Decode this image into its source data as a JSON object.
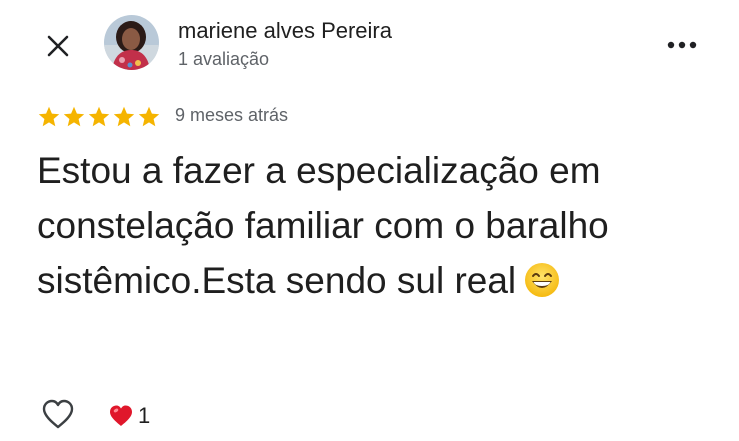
{
  "header": {
    "close_icon": "close-icon",
    "more_icon": "more-horizontal-icon"
  },
  "author": {
    "name": "mariene alves Pereira",
    "meta": "1 avaliação",
    "avatar": "avatar-photo"
  },
  "review": {
    "rating": 5,
    "rating_max": 5,
    "star_color": "#f5b400",
    "date": "9 meses atrás",
    "text": "Estou a fazer a especialização em constelação familiar com o baralho sistêmico.Esta sendo sul real",
    "emoji": "grinning-face-emoji"
  },
  "actions": {
    "like_icon": "heart-outline-icon",
    "reaction_icon": "red-heart-icon",
    "reaction_count": "1"
  }
}
